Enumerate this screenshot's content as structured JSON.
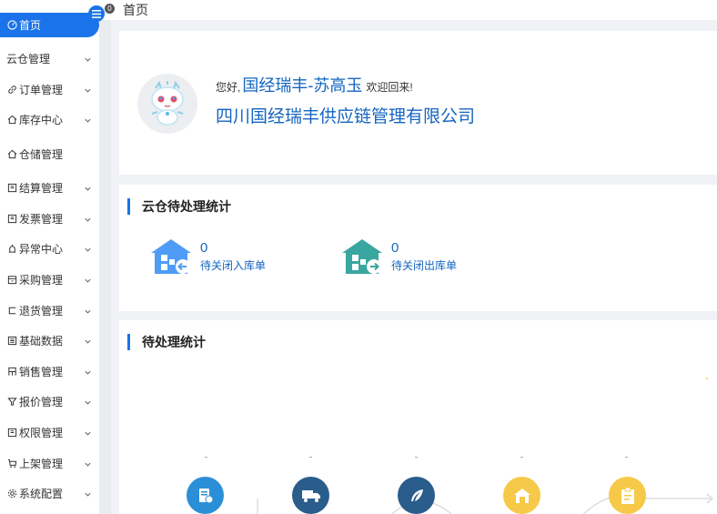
{
  "sidebar": {
    "items": [
      {
        "label": "首页",
        "icon": "dashboard-icon",
        "active": true
      },
      {
        "label": "云仓管理",
        "icon": "",
        "chevron": true
      },
      {
        "label": "订单管理",
        "icon": "link-icon",
        "chevron": true
      },
      {
        "label": "库存中心",
        "icon": "home-icon",
        "chevron": true
      },
      {
        "label": "仓储管理",
        "icon": "home-icon",
        "chevron": false
      },
      {
        "label": "结算管理",
        "icon": "doc-icon",
        "chevron": true
      },
      {
        "label": "发票管理",
        "icon": "doc-icon",
        "chevron": true
      },
      {
        "label": "异常中心",
        "icon": "alarm-icon",
        "chevron": true
      },
      {
        "label": "采购管理",
        "icon": "box-icon",
        "chevron": true
      },
      {
        "label": "退货管理",
        "icon": "return-icon",
        "chevron": true
      },
      {
        "label": "基础数据",
        "icon": "list-icon",
        "chevron": true
      },
      {
        "label": "销售管理",
        "icon": "sales-icon",
        "chevron": true
      },
      {
        "label": "报价管理",
        "icon": "filter-icon",
        "chevron": true
      },
      {
        "label": "权限管理",
        "icon": "doc-icon",
        "chevron": true
      },
      {
        "label": "上架管理",
        "icon": "cart-icon",
        "chevron": true
      },
      {
        "label": "系统配置",
        "icon": "gear-icon",
        "chevron": true
      }
    ]
  },
  "header": {
    "breadcrumb": "首页",
    "badge": "0"
  },
  "welcome": {
    "greeting_prefix": "您好,",
    "user_name": "国经瑞丰-苏高玉",
    "greeting_suffix": "欢迎回来!",
    "company": "四川国经瑞丰供应链管理有限公司"
  },
  "cloud": {
    "title": "云仓待处理统计",
    "stats": [
      {
        "value": "0",
        "label": "待关闭入库单",
        "color": "#4f9cf7"
      },
      {
        "value": "0",
        "label": "待关闭出库单",
        "color": "#3aa6a0"
      }
    ]
  },
  "pending": {
    "title": "待处理统计",
    "icon_colors": [
      "#2b8fd8",
      "#2a5d8c",
      "#2a5d8c",
      "#f7c948",
      "#f7c948"
    ]
  }
}
